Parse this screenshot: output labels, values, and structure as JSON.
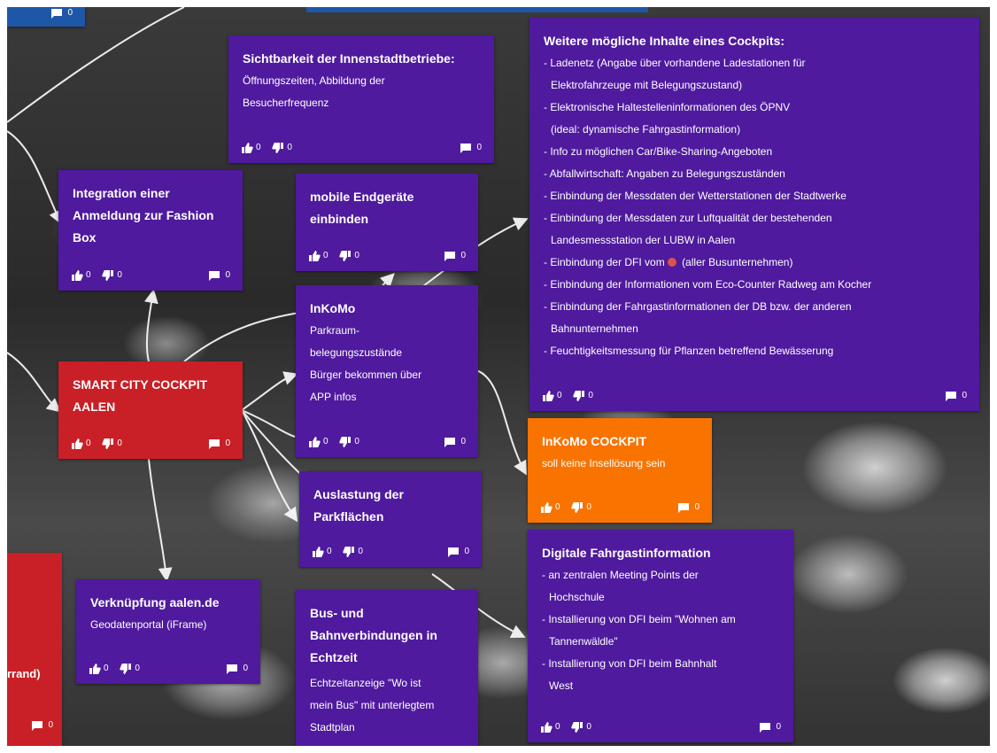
{
  "board": {
    "cards": [
      {
        "id": "topleft",
        "title": "",
        "body": [],
        "up": "",
        "down": "",
        "comments": "0"
      },
      {
        "id": "sichtbarkeit",
        "title": "Sichtbarkeit der Innenstadtbetriebe:",
        "body": [
          "Öffnungszeiten, Abbildung der",
          "Besucherfrequenz"
        ],
        "up": "0",
        "down": "0",
        "comments": "0"
      },
      {
        "id": "weitere",
        "title": "Weitere mögliche Inhalte eines Cockpits:",
        "body": [
          "- Ladenetz (Angabe über vorhandene Ladestationen für",
          "Elektrofahrzeuge mit Belegungszustand)",
          "- Elektronische Haltestelleninformationen des ÖPNV",
          "(ideal: dynamische Fahrgastinformation)",
          "- Info zu möglichen Car/Bike-Sharing-Angeboten",
          "- Abfallwirtschaft: Angaben zu Belegungszuständen",
          "- Einbindung der Messdaten der Wetterstationen der Stadtwerke",
          "- Einbindung der Messdaten zur Luftqualität der bestehenden",
          "Landesmessstation der LUBW in Aalen",
          "- Einbindung der DFI vom ",
          "- Einbindung der Informationen vom Eco-Counter Radweg am Kocher",
          "- Einbindung der Fahrgastinformationen der DB bzw. der anderen",
          "Bahnunternehmen",
          "- Feuchtigkeitsmessung für Pflanzen betreffend Bewässerung"
        ],
        "dfi_suffix": "(aller Busunternehmen)",
        "up": "0",
        "down": "0",
        "comments": "0"
      },
      {
        "id": "integration",
        "title": "Integration einer Anmeldung zur Fashion Box",
        "body": [],
        "up": "0",
        "down": "0",
        "comments": "0"
      },
      {
        "id": "mobile",
        "title": "mobile Endgeräte einbinden",
        "body": [],
        "up": "0",
        "down": "0",
        "comments": "0"
      },
      {
        "id": "inkomo",
        "title": "InKoMo",
        "body": [
          "Parkraum-",
          "belegungszustände",
          "Bürger bekommen über",
          "APP infos"
        ],
        "up": "0",
        "down": "0",
        "comments": "0"
      },
      {
        "id": "smartcity",
        "title": "SMART CITY COCKPIT AALEN",
        "body": [],
        "up": "0",
        "down": "0",
        "comments": "0"
      },
      {
        "id": "inkomocockpit",
        "title": "InKoMo COCKPIT",
        "body": [
          "soll keine Insellösung sein"
        ],
        "up": "0",
        "down": "0",
        "comments": "0"
      },
      {
        "id": "auslastung",
        "title": "Auslastung der Parkflächen",
        "body": [],
        "up": "0",
        "down": "0",
        "comments": "0"
      },
      {
        "id": "digitale",
        "title": "Digitale Fahrgastinformation",
        "body": [
          "- an zentralen Meeting Points der",
          "Hochschule",
          "- Installierung von DFI beim \"Wohnen am",
          "Tannenwäldle\"",
          "- Installierung von DFI beim Bahnhalt",
          "West"
        ],
        "up": "0",
        "down": "0",
        "comments": "0"
      },
      {
        "id": "leftred",
        "title": "rrand)",
        "body": [],
        "up": "",
        "down": "",
        "comments": "0"
      },
      {
        "id": "verknuepfung",
        "title": "Verknüpfung aalen.de",
        "body": [
          "Geodatenportal (iFrame)"
        ],
        "up": "0",
        "down": "0",
        "comments": "0"
      },
      {
        "id": "bus",
        "title": "Bus- und Bahnverbindungen in Echtzeit",
        "body": [
          "Echtzeitanzeige \"Wo ist",
          "mein Bus\" mit unterlegtem",
          "Stadtplan"
        ],
        "up": "",
        "down": "",
        "comments": ""
      }
    ]
  },
  "colors": {
    "purple": "#4f1a9e",
    "red": "#c91f26",
    "orange": "#f97300",
    "blue": "#1f57a8"
  },
  "icons": {
    "up": "thumb-up-icon",
    "down": "thumb-down-icon",
    "comment": "comment-icon"
  }
}
